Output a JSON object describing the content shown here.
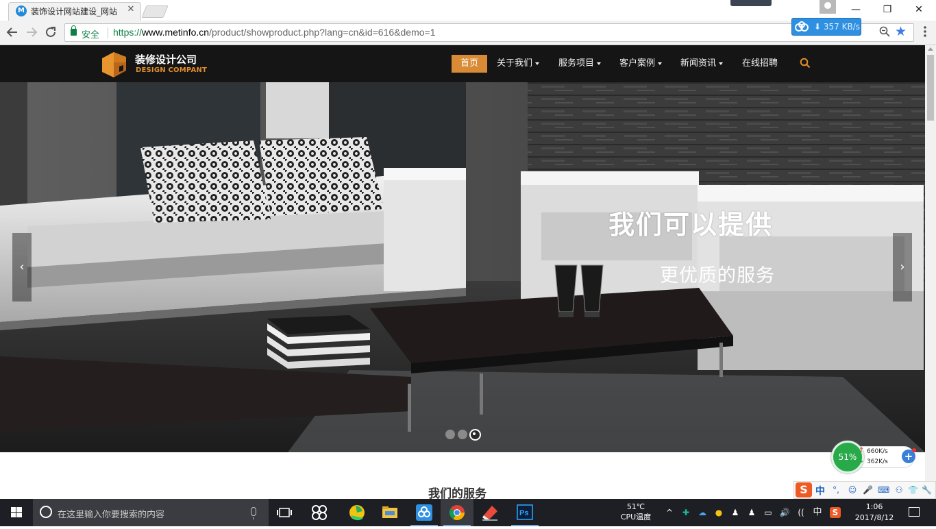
{
  "browser": {
    "tab": {
      "title": "装饰设计网站建设_网站",
      "favicon_letter": "M",
      "close": "✕"
    },
    "window_controls": {
      "minimize": "—",
      "maximize": "❐",
      "close": "✕"
    },
    "address": {
      "secure_label": "安全",
      "url_scheme": "https://",
      "url_host": "www.metinfo.cn",
      "url_path": "/product/showproduct.php?lang=cn&id=616&demo=1"
    },
    "download_widget": {
      "speed": "357 KB/s"
    },
    "accent_color": "#3d7be9"
  },
  "site": {
    "logo": {
      "name_cn": "装修设计公司",
      "name_en": "DESIGN COMPANT",
      "brand_color": "#e08c2c"
    },
    "nav": {
      "items": [
        {
          "label": "首页",
          "active": true,
          "dropdown": false
        },
        {
          "label": "关于我们",
          "active": false,
          "dropdown": true
        },
        {
          "label": "服务项目",
          "active": false,
          "dropdown": true
        },
        {
          "label": "客户案例",
          "active": false,
          "dropdown": true
        },
        {
          "label": "新闻资讯",
          "active": false,
          "dropdown": true
        },
        {
          "label": "在线招聘",
          "active": false,
          "dropdown": false
        }
      ],
      "search_icon": "search-icon",
      "active_color": "#d98a34"
    },
    "hero": {
      "title": "我们可以提供",
      "subtitle": "更优质的服务",
      "prev_arrow": "‹",
      "next_arrow": "›",
      "slides": 3,
      "active_slide": 3
    },
    "section_heading": "我们的服务"
  },
  "widgets": {
    "perf": {
      "percent": "51%",
      "upload": "660K/s",
      "download": "362K/s",
      "up_arrow": "↑",
      "down_arrow": "↓",
      "plus": "+"
    },
    "ime": {
      "logo": "S",
      "mode": "中",
      "icons": [
        "°,",
        "☺",
        "🎤",
        "⌨",
        "👕",
        "🔧"
      ]
    }
  },
  "taskbar": {
    "search_placeholder": "在这里输入你要搜索的内容",
    "cpu_temp": "51℃",
    "cpu_label": "CPU温度",
    "tray": {
      "chevron": "^",
      "ime": "中",
      "volume": "🔊",
      "wifi": "(("
    },
    "time": "1:06",
    "date": "2017/8/12"
  }
}
